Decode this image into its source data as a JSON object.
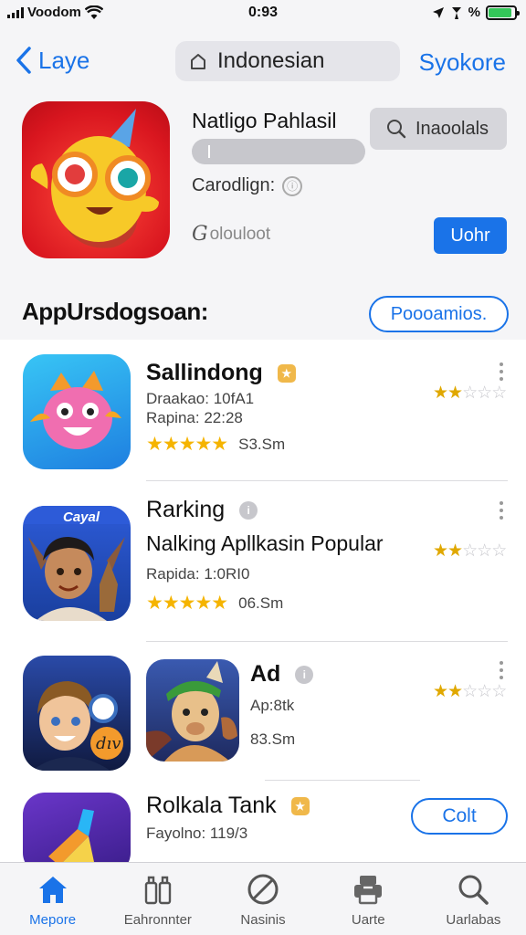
{
  "status_bar": {
    "carrier": "Voodom",
    "time": "0:93",
    "battery_percent_label": "%",
    "battery_level": 0.9,
    "battery_color": "#34c759"
  },
  "nav": {
    "back_label": "Laye",
    "search_text": "Indonesian",
    "right_label": "Syokore"
  },
  "featured": {
    "title": "Natligo Pahlasil",
    "pill_label": "Inaoolals",
    "category_label": "Carodlign:",
    "developer_text": "olouloot",
    "action_label": "Uohr"
  },
  "section": {
    "title": "AppUrsdogsoan:",
    "button_label": "Poooamios."
  },
  "apps": [
    {
      "name": "Sallindong",
      "meta_line1": "Draakao: 10fA1",
      "meta_line2": "Rapina: 22:28",
      "size": "S3.Sm",
      "rating_stars": 5,
      "side_rating": 1.5
    },
    {
      "name": "Rarking",
      "subtitle": "Nalking Apllkasin Popular",
      "icon_caption": "Cayal",
      "meta_line1": "Rapida: 1:0RI0",
      "size": "06.Sm",
      "rating_stars": 5,
      "side_rating": 1.5
    },
    {
      "name": "Ad",
      "meta_line1": "Ap:8tk",
      "size": "83.Sm",
      "side_rating": 1.5
    },
    {
      "name": "Rolkala Tank",
      "meta_line1": "Fayolno: 119/3",
      "action_label": "Colt"
    }
  ],
  "tabs": [
    {
      "label": "Mepore",
      "icon": "home-icon",
      "active": true
    },
    {
      "label": "Eahronnter",
      "icon": "bag-icon",
      "active": false
    },
    {
      "label": "Nasinis",
      "icon": "block-icon",
      "active": false
    },
    {
      "label": "Uarte",
      "icon": "printer-icon",
      "active": false
    },
    {
      "label": "Uarlabas",
      "icon": "search-icon",
      "active": false
    }
  ],
  "colors": {
    "accent": "#1a73e8",
    "star": "#f5b400",
    "background": "#f5f5f7"
  }
}
